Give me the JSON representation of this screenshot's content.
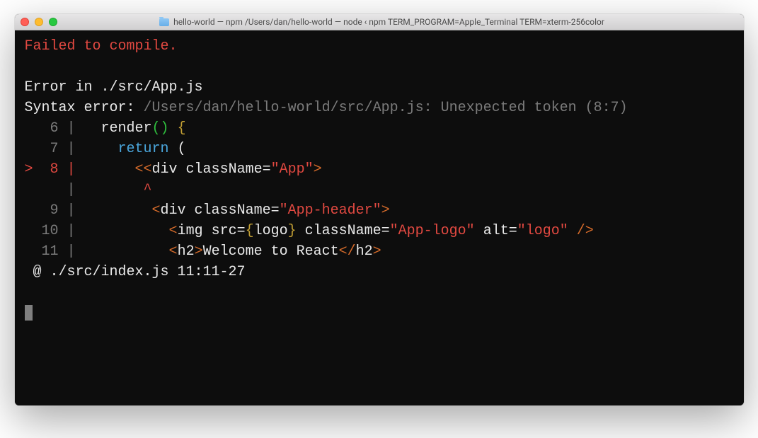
{
  "titlebar": {
    "title": "hello-world — npm  /Users/dan/hello-world — node ‹ npm TERM_PROGRAM=Apple_Terminal TERM=xterm-256color"
  },
  "error": {
    "header": "Failed to compile.",
    "fileLine": "Error in ./src/App.js",
    "syntaxPrefix": "Syntax error: ",
    "syntaxPath": "/Users/dan/hello-world/src/App.js: Unexpected token (8:7)",
    "trace": " @ ./src/index.js 11:11-27"
  },
  "code": {
    "line6": {
      "num": "   6 | ",
      "pre": "  render",
      "paren1": "()",
      "sp": " ",
      "brace": "{"
    },
    "line7": {
      "num": "   7 | ",
      "pre": "    ",
      "ret": "return",
      "post": " ("
    },
    "line8": {
      "marker": ">  8 | ",
      "pre": "      ",
      "open": "<<",
      "tag": "div className=",
      "str": "\"App\"",
      "close": ">"
    },
    "caret": {
      "num": "     | ",
      "pre": "       ",
      "mark": "^"
    },
    "line9": {
      "num": "   9 | ",
      "pre": "        ",
      "open": "<",
      "tag": "div className=",
      "str": "\"App-header\"",
      "close": ">"
    },
    "line10": {
      "num": "  10 | ",
      "pre": "          ",
      "open": "<",
      "tag": "img src=",
      "lb": "{",
      "logo": "logo",
      "rb": "}",
      "tag2": " className=",
      "str1": "\"App-logo\"",
      "alt": " alt=",
      "str2": "\"logo\"",
      "close": " />"
    },
    "line11": {
      "num": "  11 | ",
      "pre": "          ",
      "open": "<",
      "tag": "h2",
      "close1": ">",
      "text": "Welcome to React",
      "open2": "</",
      "tag2": "h2",
      "close2": ">"
    }
  }
}
